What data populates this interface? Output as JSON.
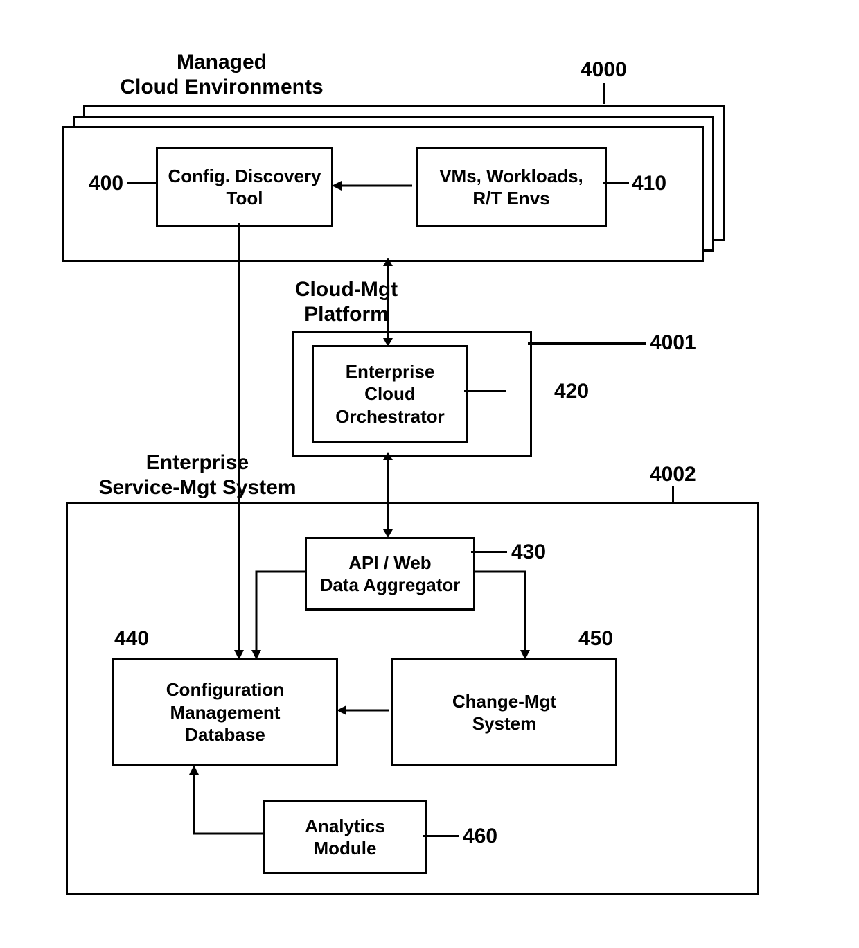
{
  "titles": {
    "managed_cloud": "Managed\nCloud Environments",
    "cloud_mgt": "Cloud-Mgt\nPlatform",
    "enterprise_svc_mgt": "Enterprise\nService-Mgt System"
  },
  "boxes": {
    "config_discovery": "Config. Discovery\nTool",
    "vms_workloads": "VMs, Workloads,\nR/T Envs",
    "orchestrator": "Enterprise\nCloud\nOrchestrator",
    "api_web": "API / Web\nData Aggregator",
    "cmdb": "Configuration\nManagement\nDatabase",
    "change_mgt": "Change-Mgt\nSystem",
    "analytics": "Analytics\nModule"
  },
  "numbers": {
    "n4000": "4000",
    "n4001": "4001",
    "n4002": "4002",
    "n400": "400",
    "n410": "410",
    "n420": "420",
    "n430": "430",
    "n440": "440",
    "n450": "450",
    "n460": "460"
  }
}
